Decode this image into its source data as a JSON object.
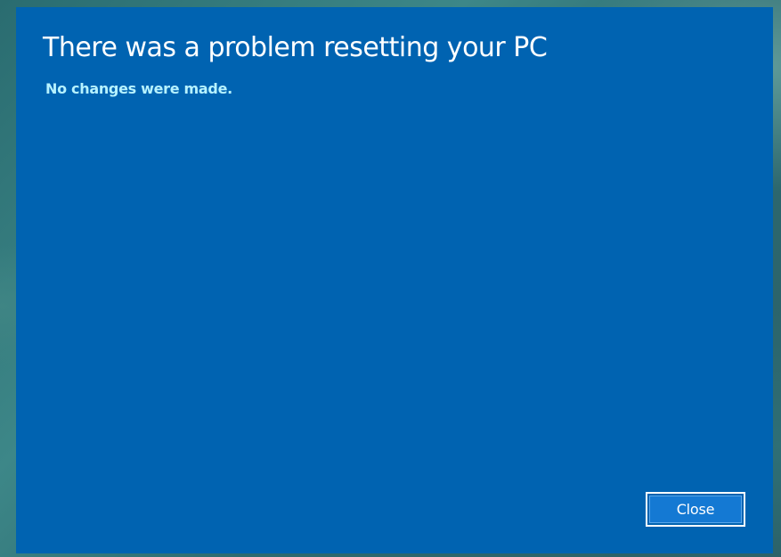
{
  "dialog": {
    "title": "There was a problem resetting your PC",
    "message": "No changes were made.",
    "close_label": "Close"
  },
  "colors": {
    "dialog_background": "#0063B1",
    "title_text": "#FFFFFF",
    "message_text": "#B6F2FF",
    "button_border": "#FFFFFF"
  }
}
